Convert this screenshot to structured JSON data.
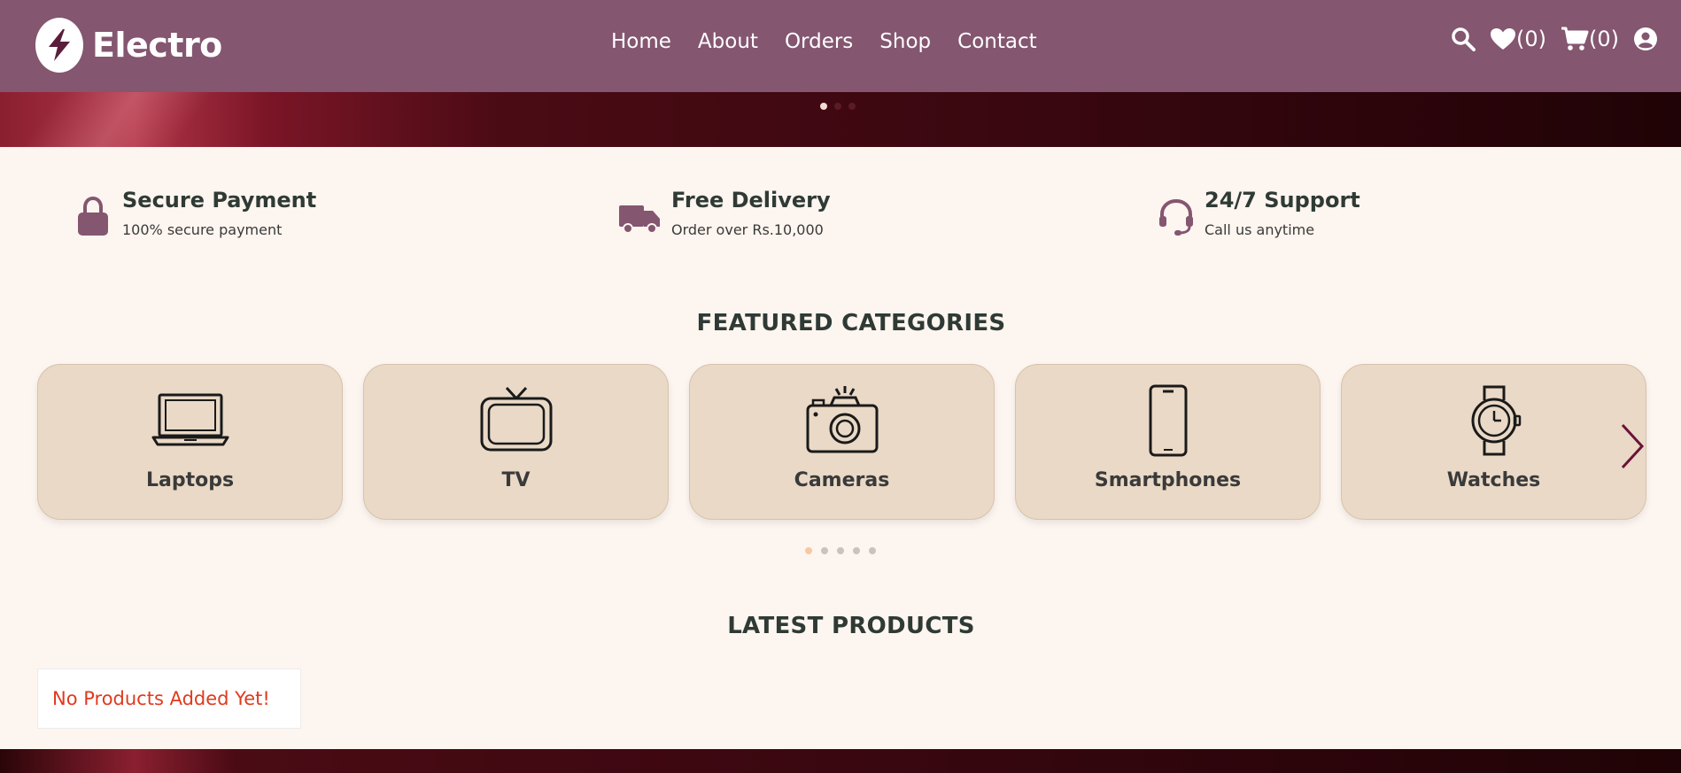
{
  "brand": {
    "name": "Electro"
  },
  "nav": {
    "links": [
      "Home",
      "About",
      "Orders",
      "Shop",
      "Contact"
    ],
    "wishlist_count": "(0)",
    "cart_count": "(0)"
  },
  "hero": {
    "slides": 3,
    "active_slide": 0
  },
  "features": [
    {
      "title": "Secure Payment",
      "subtitle": "100% secure payment",
      "icon": "lock-icon"
    },
    {
      "title": "Free Delivery",
      "subtitle": "Order over Rs.10,000",
      "icon": "truck-icon"
    },
    {
      "title": "24/7 Support",
      "subtitle": "Call us anytime",
      "icon": "headset-icon"
    }
  ],
  "featured_categories": {
    "title": "FEATURED CATEGORIES",
    "items": [
      {
        "label": "Laptops",
        "icon": "laptop-icon"
      },
      {
        "label": "TV",
        "icon": "tv-icon"
      },
      {
        "label": "Cameras",
        "icon": "camera-icon"
      },
      {
        "label": "Smartphones",
        "icon": "smartphone-icon"
      },
      {
        "label": "Watches",
        "icon": "watch-icon"
      }
    ],
    "pages": 5,
    "active_page": 0
  },
  "latest_products": {
    "title": "LATEST PRODUCTS",
    "empty_message": "No Products Added Yet!"
  },
  "colors": {
    "navbar": "#845670",
    "accent": "#845670",
    "card_bg": "#e9d9c6",
    "page_bg": "#fdf5ef",
    "empty_text": "#e03a1e"
  }
}
